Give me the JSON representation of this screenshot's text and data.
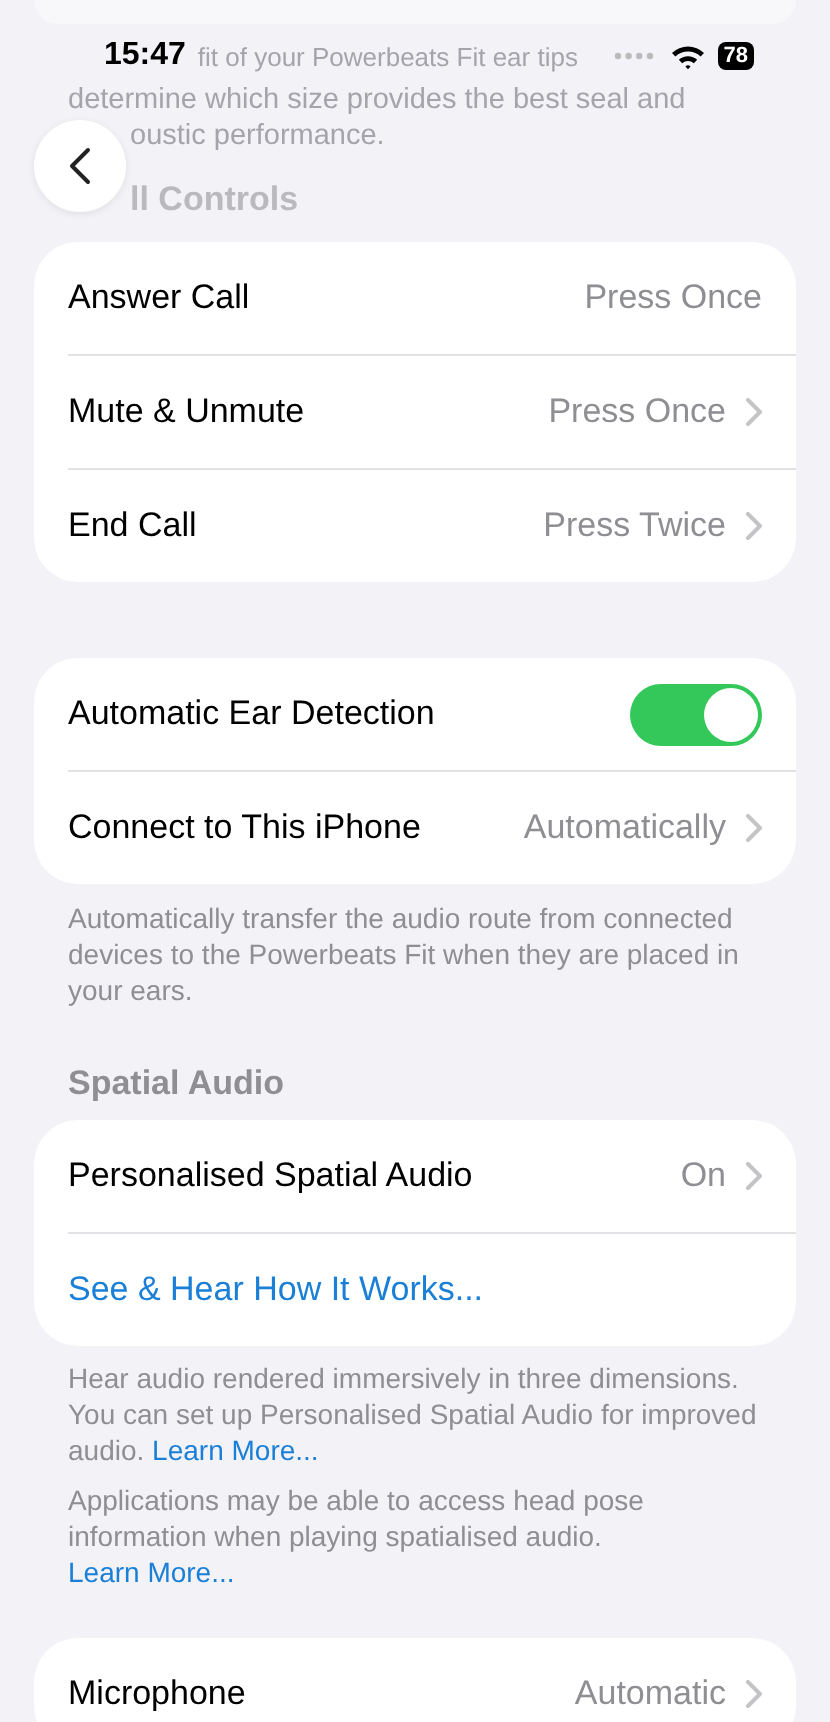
{
  "status_bar": {
    "time": "15:47",
    "battery": "78"
  },
  "faded_note": {
    "line_1": "fit of your Powerbeats Fit ear tips",
    "line_2": "determine which size provides the best seal and",
    "line_3": "oustic performance."
  },
  "call_controls": {
    "heading": "ll Controls",
    "rows": [
      {
        "label": "Answer Call",
        "value": "Press Once",
        "chevron": false
      },
      {
        "label": "Mute & Unmute",
        "value": "Press Once",
        "chevron": true
      },
      {
        "label": "End Call",
        "value": "Press Twice",
        "chevron": true
      }
    ]
  },
  "detection": {
    "rows": [
      {
        "kind": "toggle",
        "label": "Automatic Ear Detection",
        "on": true
      },
      {
        "kind": "value",
        "label": "Connect to This iPhone",
        "value": "Automatically",
        "chevron": true
      }
    ],
    "footer": "Automatically transfer the audio route from connected devices to the Powerbeats Fit when they are placed in your ears."
  },
  "spatial_audio": {
    "heading": "Spatial Audio",
    "rows": [
      {
        "kind": "value",
        "label": "Personalised Spatial Audio",
        "value": "On",
        "chevron": true
      },
      {
        "kind": "link",
        "label": "See & Hear How It Works..."
      }
    ],
    "footers": [
      {
        "text": "Hear audio rendered immersively in three dimensions. You can set up Personalised Spatial Audio for improved audio.",
        "link": "Learn More..."
      },
      {
        "text": "Applications may be able to access head pose information when playing spatialised audio.",
        "link": "Learn More..."
      }
    ]
  },
  "microphone": {
    "label": "Microphone",
    "value": "Automatic",
    "chevron": true
  }
}
